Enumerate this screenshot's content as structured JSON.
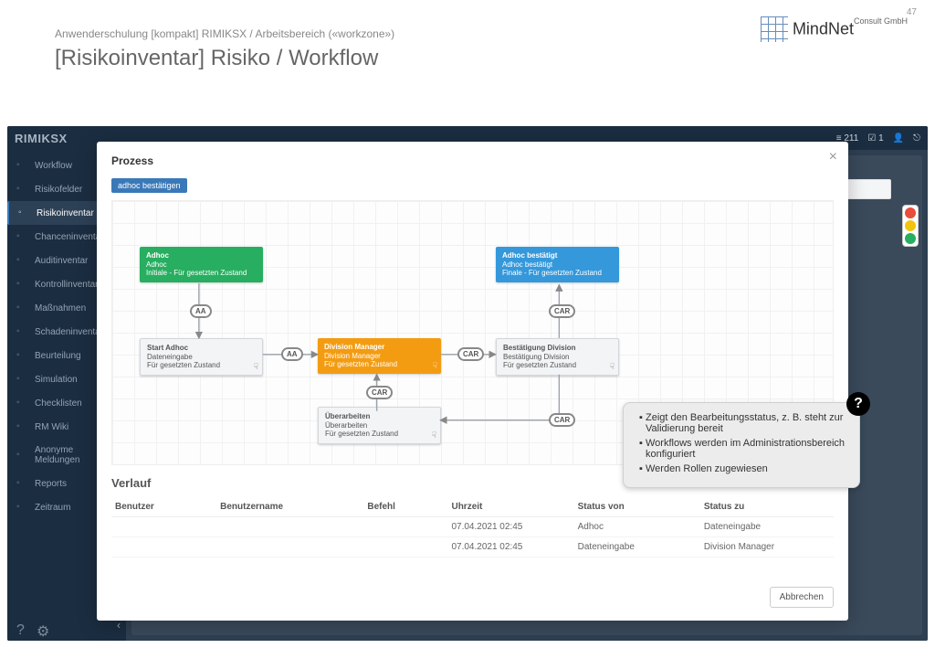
{
  "page": {
    "number": "47",
    "subtitle": "Anwenderschulung [kompakt] RIMIKSX / Arbeitsbereich («workzone»)",
    "title": "[Risikoinventar] Risiko / Workflow",
    "brand": "MindNet",
    "brand_sub": "Consult GmbH"
  },
  "app": {
    "logo": "RIMIKSX",
    "topbar": {
      "count": "211",
      "tasks": "1"
    },
    "sidebar": {
      "items": [
        {
          "label": "Workflow",
          "active": false
        },
        {
          "label": "Risikofelder",
          "active": false
        },
        {
          "label": "Risikoinventar",
          "active": true
        },
        {
          "label": "Chanceninventar",
          "active": false
        },
        {
          "label": "Auditinventar",
          "active": false
        },
        {
          "label": "Kontrollinventar",
          "active": false
        },
        {
          "label": "Maßnahmen",
          "active": false
        },
        {
          "label": "Schadeninventar",
          "active": false
        },
        {
          "label": "Beurteilung",
          "active": false
        },
        {
          "label": "Simulation",
          "active": false
        },
        {
          "label": "Checklisten",
          "active": false
        },
        {
          "label": "RM Wiki",
          "active": false
        },
        {
          "label": "Anonyme Meldungen",
          "active": false
        },
        {
          "label": "Reports",
          "active": false
        },
        {
          "label": "Zeitraum",
          "active": false
        }
      ]
    }
  },
  "modal": {
    "title": "Prozess",
    "action_pill": "adhoc bestätigen",
    "cancel": "Abbrechen"
  },
  "diagram": {
    "nodes": {
      "adhoc": {
        "l1": "Adhoc",
        "l2": "Adhoc",
        "l3": "Initiale - Für gesetzten Zustand"
      },
      "start": {
        "l1": "Start Adhoc",
        "l2": "Dateneingabe",
        "l3": "Für gesetzten Zustand"
      },
      "dm": {
        "l1": "Division Manager",
        "l2": "Division Manager",
        "l3": "Für gesetzten Zustand"
      },
      "conf": {
        "l1": "Adhoc bestätigt",
        "l2": "Adhoc bestätigt",
        "l3": "Finale - Für gesetzten Zustand"
      },
      "best": {
        "l1": "Bestätigung Division",
        "l2": "Bestätigung Division",
        "l3": "Für gesetzten Zustand"
      },
      "ueber": {
        "l1": "Überarbeiten",
        "l2": "Überarbeiten",
        "l3": "Für gesetzten Zustand"
      }
    },
    "badges": {
      "aa": "AA",
      "car": "CAR"
    }
  },
  "tooltip": {
    "items": [
      "Zeigt den Bearbeitungsstatus, z. B. steht zur Validierung bereit",
      "Workflows werden im Administrationsbereich konfiguriert",
      "Werden Rollen zugewiesen"
    ]
  },
  "history": {
    "title": "Verlauf",
    "columns": [
      "Benutzer",
      "Benutzername",
      "Befehl",
      "Uhrzeit",
      "Status von",
      "Status zu"
    ],
    "rows": [
      {
        "user": "",
        "username": "",
        "cmd": "",
        "time": "07.04.2021 02:45",
        "from": "Adhoc",
        "to": "Dateneingabe"
      },
      {
        "user": "",
        "username": "",
        "cmd": "",
        "time": "07.04.2021 02:45",
        "from": "Dateneingabe",
        "to": "Division Manager"
      }
    ]
  }
}
